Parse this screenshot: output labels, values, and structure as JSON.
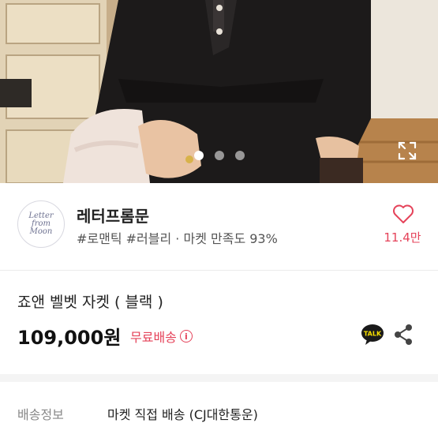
{
  "gallery": {
    "dots": [
      {
        "active": true
      },
      {
        "active": false
      },
      {
        "active": false
      }
    ],
    "icons": {
      "expand": "expand-icon"
    }
  },
  "shop": {
    "logo_lines": [
      "Letter",
      "from",
      "Moon"
    ],
    "name": "레터프롬문",
    "tags": "#로맨틱 #러블리 · 마켓 만족도 93%",
    "like_count": "11.4만",
    "icons": {
      "like": "heart-icon"
    }
  },
  "product": {
    "title": "죠앤 벨벳 자켓 ( 블랙 )",
    "price": "109,000원",
    "shipping_badge": "무료배송",
    "info_symbol": "i",
    "icons": {
      "talk": "kakao-talk-icon",
      "share": "share-icon"
    },
    "talk_label": "TALK"
  },
  "shipping_info": {
    "label": "배송정보",
    "value": "마켓 직접 배송 (CJ대한통운)"
  },
  "colors": {
    "accent": "#e5435a",
    "talk_yellow": "#f9e000",
    "divider": "#ececec"
  }
}
